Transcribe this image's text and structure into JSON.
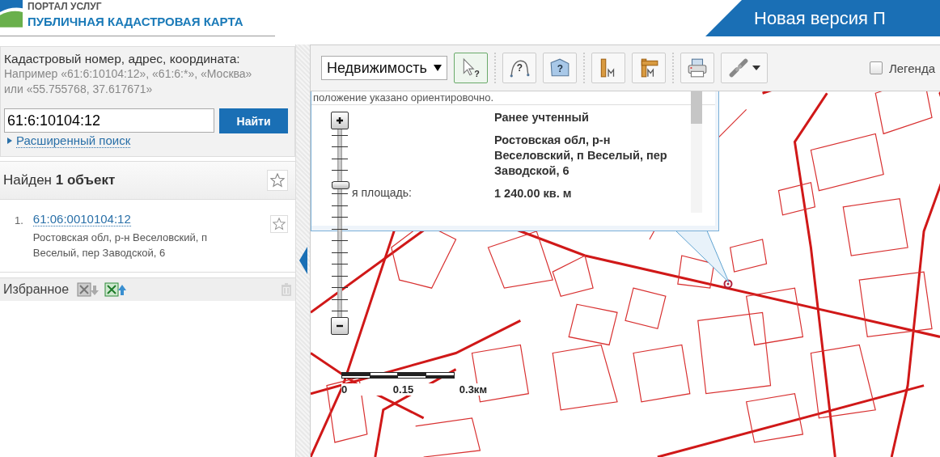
{
  "header": {
    "portal": "ПОРТАЛ УСЛУГ",
    "title": "ПУБЛИЧНАЯ КАДАСТРОВАЯ КАРТА",
    "banner": "Новая версия П"
  },
  "search": {
    "label": "Кадастровый номер, адрес, координата:",
    "hint": "Например «61:6:10104:12», «61:6:*», «Москва» или «55.755768, 37.617671»",
    "value": "61:6:10104:12",
    "button": "Найти",
    "advanced_link": "Расширенный поиск"
  },
  "results": {
    "title": "Найден **1 объект**",
    "items": [
      {
        "number": "1.",
        "link": "61:06:0010104:12",
        "address": "Ростовская обл, р-н Веселовский, п Веселый, пер Заводской, 6"
      }
    ]
  },
  "favorites": {
    "title": "Избранное"
  },
  "toolbar": {
    "layer_select": "Недвижимость",
    "tools": [
      {
        "kind": "pointer",
        "selected": true,
        "mark": "?"
      },
      {
        "kind": "curve-query",
        "selected": false,
        "mark": "?"
      },
      {
        "kind": "polygon-query",
        "selected": false,
        "mark": "?"
      },
      {
        "kind": "ruler",
        "selected": false
      },
      {
        "kind": "area-ruler",
        "selected": false
      },
      {
        "kind": "print",
        "selected": false
      },
      {
        "kind": "link",
        "selected": false
      }
    ],
    "legend": {
      "label": "Легенда",
      "checked": false
    }
  },
  "popup": {
    "note": "положение указано ориентировочно.",
    "rows": [
      {
        "value": "Ранее учтенный"
      },
      {
        "value": "Ростовская обл, р-н Веселовский, п Веселый, пер Заводской, 6"
      },
      {
        "label": "я площадь:",
        "value": "1 240.00 кв. м"
      }
    ]
  },
  "zoom": {
    "level": 0.68
  },
  "scale": {
    "labels": [
      "0",
      "0.15",
      "0.3км"
    ]
  }
}
